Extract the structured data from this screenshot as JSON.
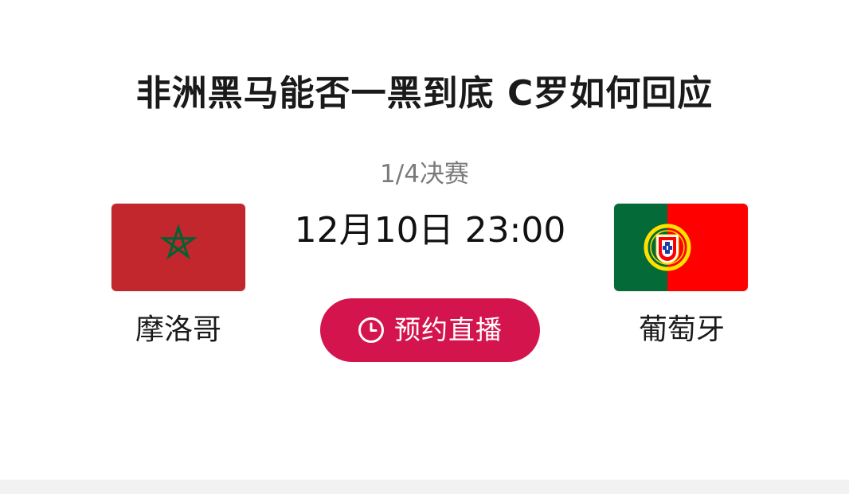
{
  "match": {
    "title": "非洲黑马能否一黑到底 C罗如何回应",
    "stage": "1/4决赛",
    "datetime": "12月10日 23:00",
    "reserve_label": "预约直播"
  },
  "teams": [
    {
      "name": "摩洛哥",
      "flag_icon": "morocco-flag-icon"
    },
    {
      "name": "葡萄牙",
      "flag_icon": "portugal-flag-icon"
    }
  ],
  "colors": {
    "button": "#d4144d",
    "morocco_red": "#c1272d",
    "morocco_star": "#006233",
    "portugal_green": "#046a38",
    "portugal_red": "#ff0000",
    "portugal_yellow": "#ffe000"
  }
}
